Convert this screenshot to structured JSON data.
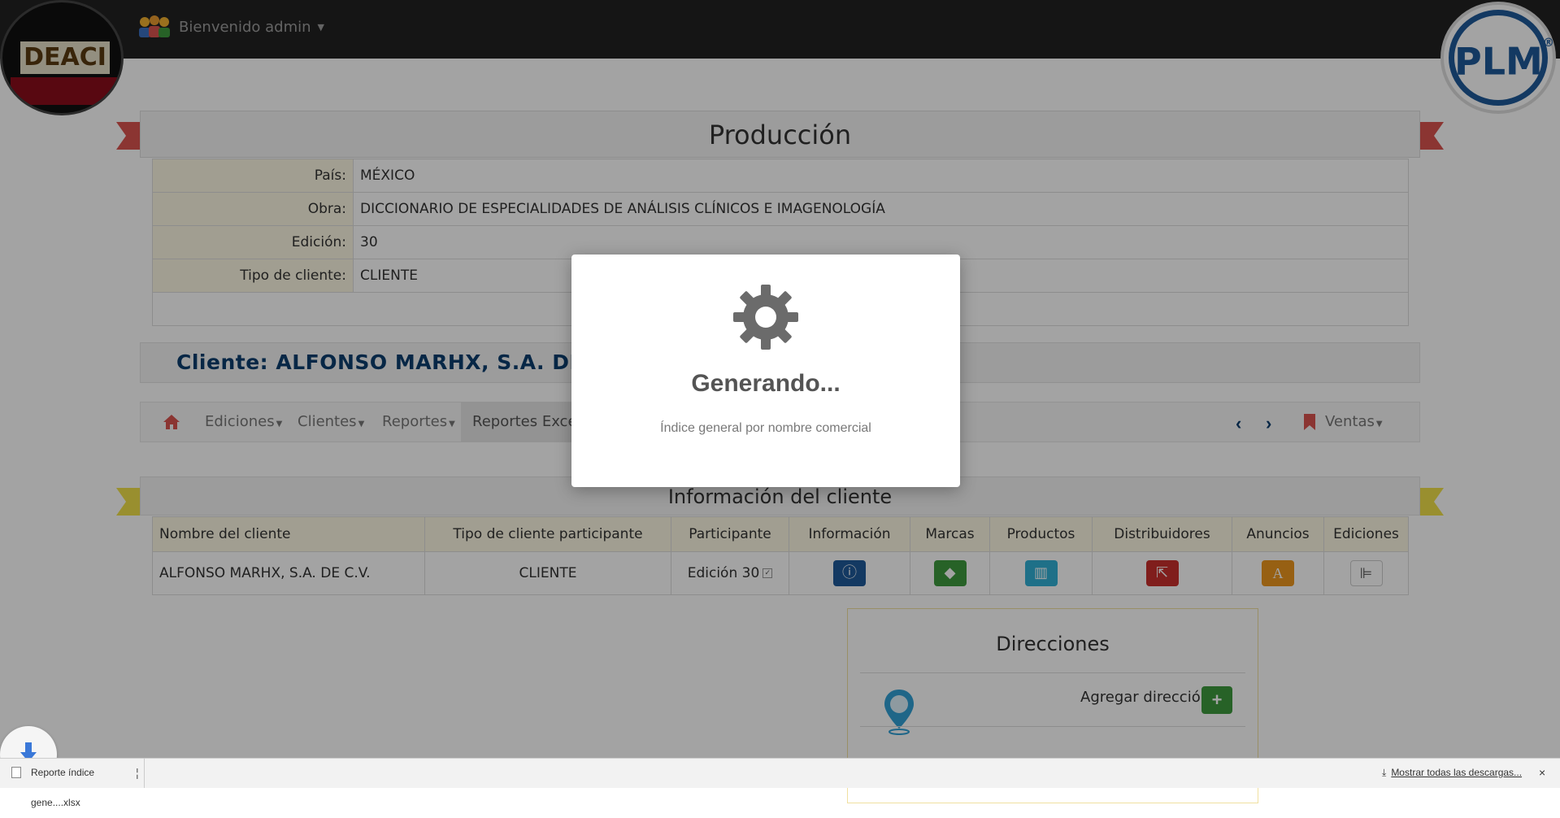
{
  "navbar": {
    "user_label": "Bienvenido admin",
    "logo_left_text": "DEACI",
    "logo_right_text": "PLM",
    "logo_right_mark": "®"
  },
  "produccion": {
    "title": "Producción",
    "rows": [
      {
        "label": "País:",
        "value": "MÉXICO"
      },
      {
        "label": "Obra:",
        "value": "DICCIONARIO DE ESPECIALIDADES DE ANÁLISIS CLÍNICOS E IMAGENOLOGÍA"
      },
      {
        "label": "Edición:",
        "value": "30"
      },
      {
        "label": "Tipo de cliente:",
        "value": "CLIENTE"
      }
    ]
  },
  "cliente": {
    "label": "Cliente: ALFONSO MARHX, S.A. DE C.V."
  },
  "subnav": {
    "ediciones": "Ediciones",
    "clientes": "Clientes",
    "reportes": "Reportes",
    "reportes_excel": "Reportes Excel",
    "ventas": "Ventas"
  },
  "client_info": {
    "title": "Información del cliente",
    "headers": [
      "Nombre del cliente",
      "Tipo de cliente participante",
      "Participante",
      "Información",
      "Marcas",
      "Productos",
      "Distribuidores",
      "Anuncios",
      "Ediciones"
    ],
    "row": {
      "nombre": "ALFONSO MARHX, S.A. DE C.V.",
      "tipo": "CLIENTE",
      "participante": "Edición 30"
    }
  },
  "direcciones": {
    "title": "Direcciones",
    "add_label": "Agregar dirección"
  },
  "modal": {
    "title": "Generando...",
    "text": "Índice general por nombre comercial"
  },
  "downloads": {
    "file_name": "Reporte índice gene....xlsx",
    "show_all": "Mostrar todas las descargas...",
    "close": "×"
  },
  "colors": {
    "navbar": "#222222",
    "accent_red": "#d9534f",
    "accent_yellow": "#f0e04a",
    "brand_blue": "#1f5a99"
  }
}
